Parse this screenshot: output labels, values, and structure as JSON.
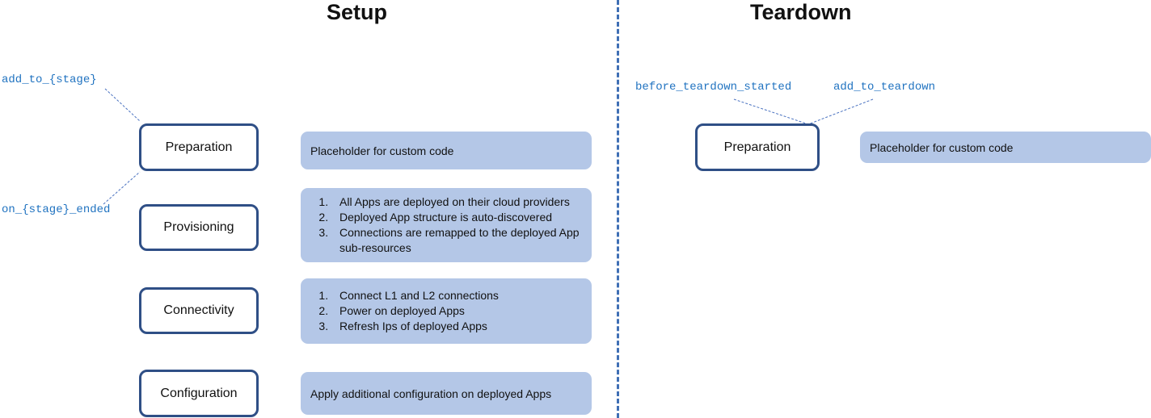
{
  "setup": {
    "title": "Setup",
    "hooks": {
      "before": "add_to_{stage}",
      "after": "on_{stage}_ended"
    },
    "stages": [
      {
        "name": "Preparation",
        "description": "Placeholder for custom code"
      },
      {
        "name": "Provisioning",
        "steps": [
          "All Apps are deployed on their cloud providers",
          "Deployed App structure is auto-discovered",
          "Connections are remapped to the deployed App sub-resources"
        ]
      },
      {
        "name": "Connectivity",
        "steps": [
          "Connect L1 and L2 connections",
          "Power on deployed Apps",
          "Refresh Ips of deployed Apps"
        ]
      },
      {
        "name": "Configuration",
        "description": "Apply additional configuration on deployed Apps"
      }
    ]
  },
  "teardown": {
    "title": "Teardown",
    "hooks": {
      "before_started": "before_teardown_started",
      "add_to": "add_to_teardown"
    },
    "stages": [
      {
        "name": "Preparation",
        "description": "Placeholder for custom code"
      }
    ]
  },
  "colors": {
    "stage_border": "#2f4f86",
    "description_fill": "#b4c7e7",
    "hook_text": "#1f72c0",
    "divider": "#3f6fb5"
  }
}
